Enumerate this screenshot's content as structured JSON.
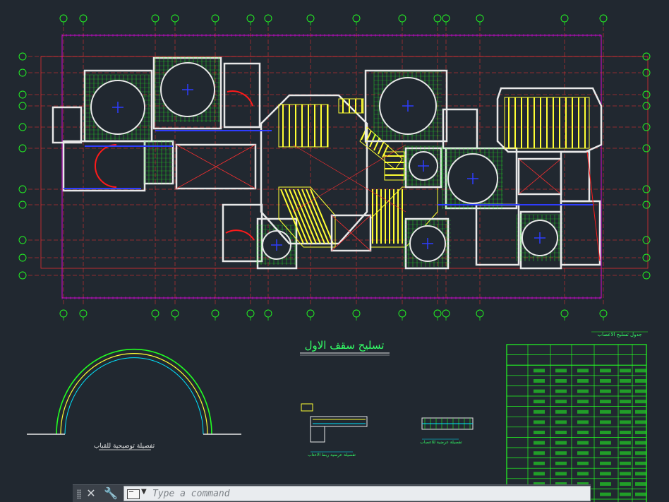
{
  "app": {
    "name": "CAD drawing canvas"
  },
  "drawing": {
    "title_label": "تسليح سقف الاول",
    "arch_detail_label": "تفصيلة توضيحية للقباب",
    "section_label_1": "تفصيلة عرضية ربط الاعتاب",
    "section_label_2": "تفصيلة عرضية للاعصاب",
    "table_header": "جدول تسليح الاعصاب",
    "table_rows": 15,
    "grid_bubble_count_top": 16,
    "grid_bubble_count_side": 10
  },
  "colors": {
    "background": "#212830",
    "walls": "#e8e8e8",
    "hatch": "#22ff22",
    "ribs": "#ffff33",
    "grid": "#ff3030",
    "dims": "#ff00ff",
    "text": "#33ff66",
    "blue": "#2e3cff",
    "cyan": "#00e5ff"
  },
  "command_line": {
    "placeholder": "Type a command",
    "close_icon": "close-icon",
    "customize_icon": "wrench-icon"
  }
}
